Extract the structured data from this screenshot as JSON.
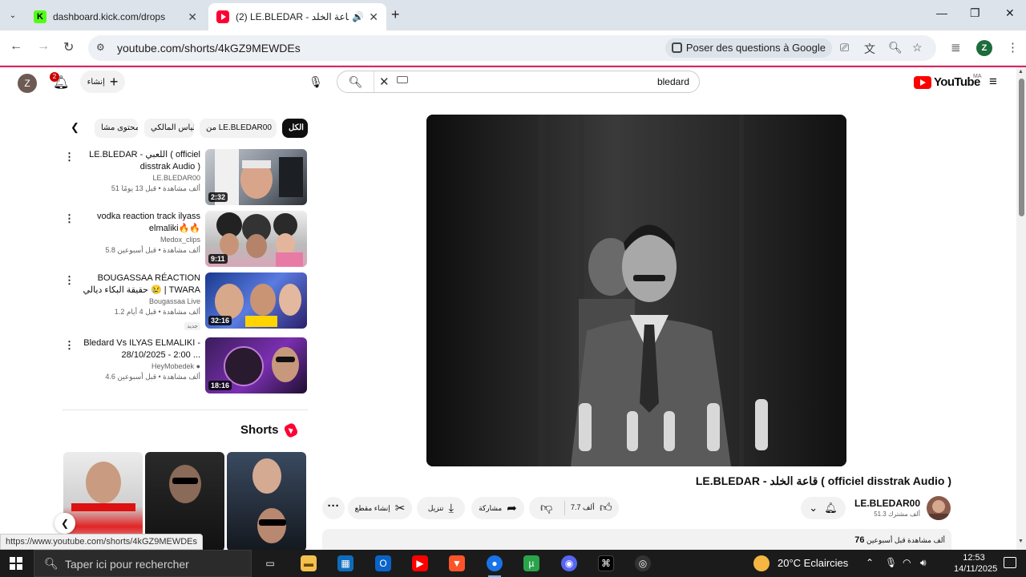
{
  "tabs": [
    {
      "title": "dashboard.kick.com/drops",
      "favicon": "kick-icon"
    },
    {
      "title": "(2) LE.BLEDAR - قاعة الخلد ( ",
      "favicon": "youtube-icon",
      "audio": true
    }
  ],
  "address_bar": {
    "url": "youtube.com/shorts/4kGZ9MEWDEs",
    "ask_google": "Poser des questions à Google"
  },
  "profile_letter": "Z",
  "youtube": {
    "avatar_letter": "Z",
    "notification_count": "2",
    "create_label": "إنشاء",
    "search_value": "bledard",
    "logo_text": "YouTube",
    "region": "MA"
  },
  "chips": [
    {
      "label": "الكل",
      "active": true
    },
    {
      "label": "من LE.BLEDAR00",
      "active": false
    },
    {
      "label": "إلياس المالكي",
      "active": false
    },
    {
      "label": "محتوى مشا",
      "active": false
    }
  ],
  "related": [
    {
      "title": "LE.BLEDAR - اللعبي ( officiel disstrak Audio )",
      "channel": "LE.BLEDAR00",
      "meta": "51 ألف مشاهدة • قبل 13 يومًا",
      "duration": "2:32",
      "badge": ""
    },
    {
      "title": "vodka reaction track ilyass elmaliki🔥🔥",
      "channel": "Medox_clips",
      "meta": "5.8 ألف مشاهدة • قبل أسبوعين",
      "duration": "9:11",
      "badge": ""
    },
    {
      "title": "BOUGASSAA RÉACTION حقيقة البكاء ديالي 😢 | TWARA",
      "channel": "Bougassaa Live",
      "meta": "1.2 ألف مشاهدة • قبل 4 أيام",
      "duration": "32:16",
      "badge": "جديد"
    },
    {
      "title": "Bledard Vs ILYAS ELMALIKI - 28/10/2025 - 2:00 ...",
      "channel": "HeyMobedek",
      "meta": "4.6 ألف مشاهدة • قبل أسبوعين",
      "duration": "18:16",
      "badge": ""
    }
  ],
  "shorts_label": "Shorts",
  "video": {
    "title": "LE.BLEDAR - قاعة الخلد ( officiel disstrak Audio )",
    "channel": "LE.BLEDAR00",
    "subscribers": "51.3 ألف مشترك",
    "likes": "7.7 ألف",
    "share_label": "مشاركة",
    "download_label": "تنزيل",
    "clip_label": "إنشاء مقطع",
    "views": "76",
    "views_suffix": "ألف مشاهدة  قبل أسبوعين"
  },
  "status_url": "https://www.youtube.com/shorts/4kGZ9MEWDEs",
  "taskbar": {
    "search_placeholder": "Taper ici pour rechercher",
    "weather": "20°C  Eclaircies",
    "time": "12:53",
    "date": "14/11/2025"
  },
  "colors": {
    "youtube_red": "#ff0000",
    "kick_green": "#53fc18",
    "chrome_tabstrip": "#dde3ea",
    "taskbar": "#1b1b1b"
  }
}
